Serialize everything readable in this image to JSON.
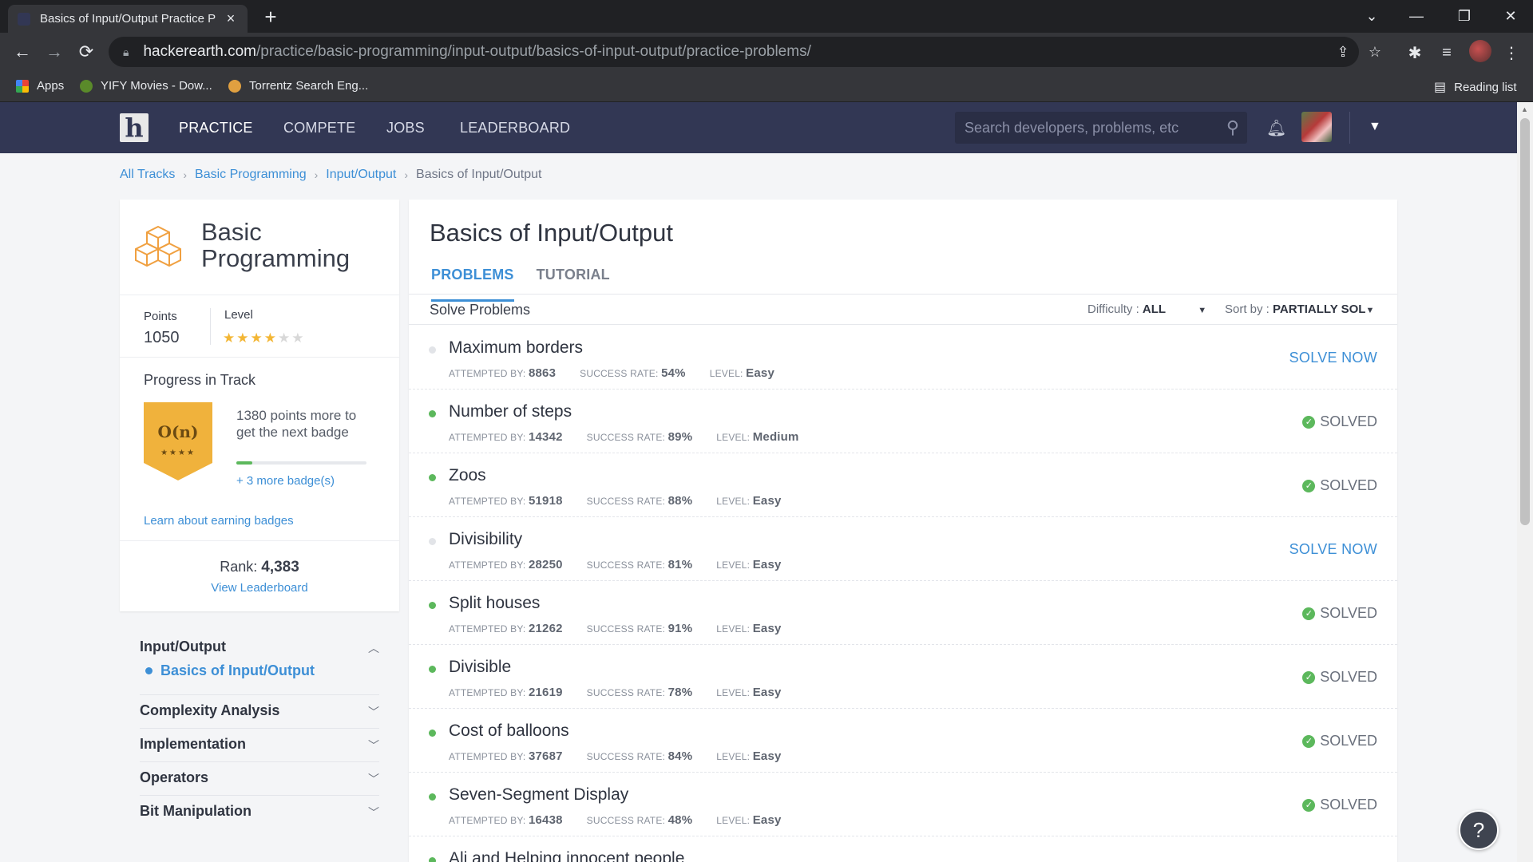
{
  "browser": {
    "tab_title": "Basics of Input/Output Practice P",
    "url_host": "hackerearth.com",
    "url_path": "/practice/basic-programming/input-output/basics-of-input-output/practice-problems/",
    "bookmarks": [
      {
        "label": "Apps"
      },
      {
        "label": "YIFY Movies - Dow..."
      },
      {
        "label": "Torrentz Search Eng..."
      }
    ],
    "reading_list": "Reading list"
  },
  "nav": {
    "practice": "PRACTICE",
    "compete": "COMPETE",
    "jobs": "JOBS",
    "leaderboard": "LEADERBOARD",
    "search_placeholder": "Search developers, problems, etc"
  },
  "breadcrumb": {
    "items": [
      "All Tracks",
      "Basic Programming",
      "Input/Output"
    ],
    "current": "Basics of Input/Output"
  },
  "track": {
    "name": "Basic Programming",
    "points_label": "Points",
    "points": "1050",
    "level_label": "Level",
    "level_stars": 4,
    "level_max": 6,
    "progress_title": "Progress in Track",
    "badge_symbol": "O(n)",
    "badge_stars": "★★★★",
    "badge_text": "1380 points more to get the next badge",
    "badge_progress": 0.12,
    "more_badges": "+ 3 more badge(s)",
    "learn_link": "Learn about earning badges",
    "rank_label": "Rank:",
    "rank": "4,383",
    "view_leaderboard": "View Leaderboard"
  },
  "topics": {
    "active": "Input/Output",
    "active_sub": "Basics of Input/Output",
    "others": [
      "Complexity Analysis",
      "Implementation",
      "Operators",
      "Bit Manipulation"
    ]
  },
  "main": {
    "title": "Basics of Input/Output",
    "tab_problems": "PROBLEMS",
    "tab_tutorial": "TUTORIAL",
    "solve_label": "Solve Problems",
    "difficulty_label": "Difficulty :",
    "difficulty_value": "ALL",
    "sort_label": "Sort by :",
    "sort_value": "PARTIALLY SOL"
  },
  "meta_labels": {
    "attempted": "ATTEMPTED BY:",
    "success": "SUCCESS RATE:",
    "level": "LEVEL:"
  },
  "actions": {
    "solve_now": "SOLVE NOW",
    "solved": "SOLVED"
  },
  "problems": [
    {
      "name": "Maximum borders",
      "attempted": "8863",
      "success": "54%",
      "level": "Easy",
      "solved": false
    },
    {
      "name": "Number of steps",
      "attempted": "14342",
      "success": "89%",
      "level": "Medium",
      "solved": true
    },
    {
      "name": "Zoos",
      "attempted": "51918",
      "success": "88%",
      "level": "Easy",
      "solved": true
    },
    {
      "name": "Divisibility",
      "attempted": "28250",
      "success": "81%",
      "level": "Easy",
      "solved": false
    },
    {
      "name": "Split houses",
      "attempted": "21262",
      "success": "91%",
      "level": "Easy",
      "solved": true
    },
    {
      "name": "Divisible",
      "attempted": "21619",
      "success": "78%",
      "level": "Easy",
      "solved": true
    },
    {
      "name": "Cost of balloons",
      "attempted": "37687",
      "success": "84%",
      "level": "Easy",
      "solved": true
    },
    {
      "name": "Seven-Segment Display",
      "attempted": "16438",
      "success": "48%",
      "level": "Easy",
      "solved": true
    },
    {
      "name": "Ali and Helping innocent people",
      "attempted": "",
      "success": "",
      "level": "",
      "solved": true
    }
  ],
  "colors": {
    "nav_bg": "#323754",
    "link": "#3d8fd6",
    "solved": "#5cb85c",
    "star": "#f3b634",
    "badge": "#f0b23c"
  }
}
